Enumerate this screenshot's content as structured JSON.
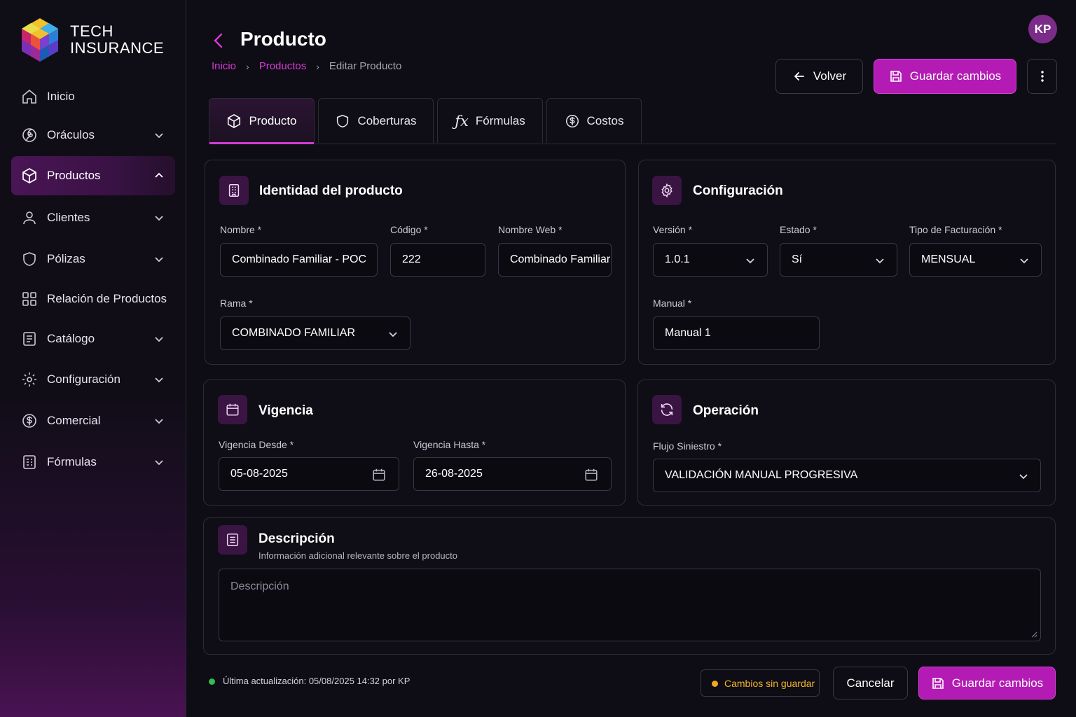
{
  "brand": {
    "line1": "TECH",
    "line2": "INSURANCE"
  },
  "nav": {
    "items": [
      {
        "label": "Inicio",
        "icon": "home-icon",
        "expandable": false,
        "active": false
      },
      {
        "label": "Oráculos",
        "icon": "spiral-icon",
        "expandable": true,
        "active": false
      },
      {
        "label": "Productos",
        "icon": "box-icon",
        "expandable": true,
        "active": true
      },
      {
        "label": "Clientes",
        "icon": "user-icon",
        "expandable": true,
        "active": false
      },
      {
        "label": "Pólizas",
        "icon": "shield-icon",
        "expandable": true,
        "active": false
      },
      {
        "label": "Relación de Productos",
        "icon": "grid-icon",
        "expandable": false,
        "active": false
      },
      {
        "label": "Catálogo",
        "icon": "document-icon",
        "expandable": true,
        "active": false
      },
      {
        "label": "Configuración",
        "icon": "gear-icon",
        "expandable": true,
        "active": false
      },
      {
        "label": "Comercial",
        "icon": "dollar-circle-icon",
        "expandable": true,
        "active": false
      },
      {
        "label": "Fórmulas",
        "icon": "calculator-icon",
        "expandable": true,
        "active": false
      }
    ]
  },
  "header": {
    "title": "Producto",
    "breadcrumb": {
      "home": "Inicio",
      "section": "Productos",
      "current": "Editar Producto"
    },
    "back_label": "Volver",
    "save_label": "Guardar cambios",
    "avatar_initials": "KP"
  },
  "tabs": [
    {
      "label": "Producto",
      "icon": "box-icon",
      "active": true
    },
    {
      "label": "Coberturas",
      "icon": "shield-icon",
      "active": false
    },
    {
      "label": "Fórmulas",
      "icon": "function-icon",
      "active": false
    },
    {
      "label": "Costos",
      "icon": "dollar-circle-icon",
      "active": false
    }
  ],
  "identity": {
    "title": "Identidad del producto",
    "nombre_label": "Nombre *",
    "nombre_value": "Combinado Familiar - POC",
    "codigo_label": "Código *",
    "codigo_value": "222",
    "nombre_web_label": "Nombre Web *",
    "nombre_web_value": "Combinado Familiar",
    "rama_label": "Rama *",
    "rama_value": "COMBINADO FAMILIAR"
  },
  "config": {
    "title": "Configuración",
    "version_label": "Versión *",
    "version_value": "1.0.1",
    "estado_label": "Estado *",
    "estado_value": "Sí",
    "facturacion_label": "Tipo de Facturación *",
    "facturacion_value": "MENSUAL",
    "manual_label": "Manual *",
    "manual_value": "Manual 1"
  },
  "vigencia": {
    "title": "Vigencia",
    "desde_label": "Vigencia Desde *",
    "desde_value": "05-08-2025",
    "hasta_label": "Vigencia Hasta *",
    "hasta_value": "26-08-2025"
  },
  "operacion": {
    "title": "Operación",
    "flujo_label": "Flujo Siniestro *",
    "flujo_value": "VALIDACIÓN MANUAL PROGRESIVA"
  },
  "descripcion": {
    "title": "Descripción",
    "subtitle": "Información adicional relevante sobre el producto",
    "placeholder": "Descripción"
  },
  "footer": {
    "last_update": "Última actualización: 05/08/2025 14:32 por KP",
    "unsaved": "Cambios sin guardar",
    "cancel_label": "Cancelar",
    "save_label": "Guardar cambios"
  },
  "colors": {
    "accent": "#b41ab4",
    "accent_text": "#d63bd6",
    "success": "#2fbf4f",
    "warning": "#f2a91c",
    "background": "#0e0c14"
  }
}
